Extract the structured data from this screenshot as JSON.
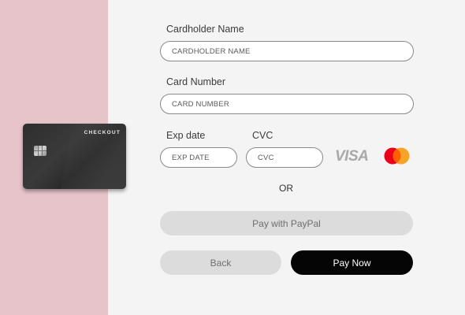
{
  "card": {
    "brand": "CHECKOUT"
  },
  "form": {
    "cardholder_label": "Cardholder Name",
    "cardholder_placeholder": "CARDHOLDER NAME",
    "card_number_label": "Card Number",
    "card_number_placeholder": "CARD NUMBER",
    "exp_label": "Exp date",
    "exp_placeholder": "EXP DATE",
    "cvc_label": "CVC",
    "cvc_placeholder": "CVC"
  },
  "payment_logos": {
    "visa": "VISA",
    "mastercard_icon": "mastercard-icon"
  },
  "or_text": "OR",
  "buttons": {
    "paypal": "Pay with PayPal",
    "back": "Back",
    "pay_now": "Pay Now"
  },
  "colors": {
    "left_panel": "#e6c4c9",
    "background": "#f4f4f4",
    "primary_button": "#050505",
    "secondary_button": "#dcdcdc",
    "mastercard_red": "#eb001b",
    "mastercard_yellow": "#f79e1b"
  }
}
